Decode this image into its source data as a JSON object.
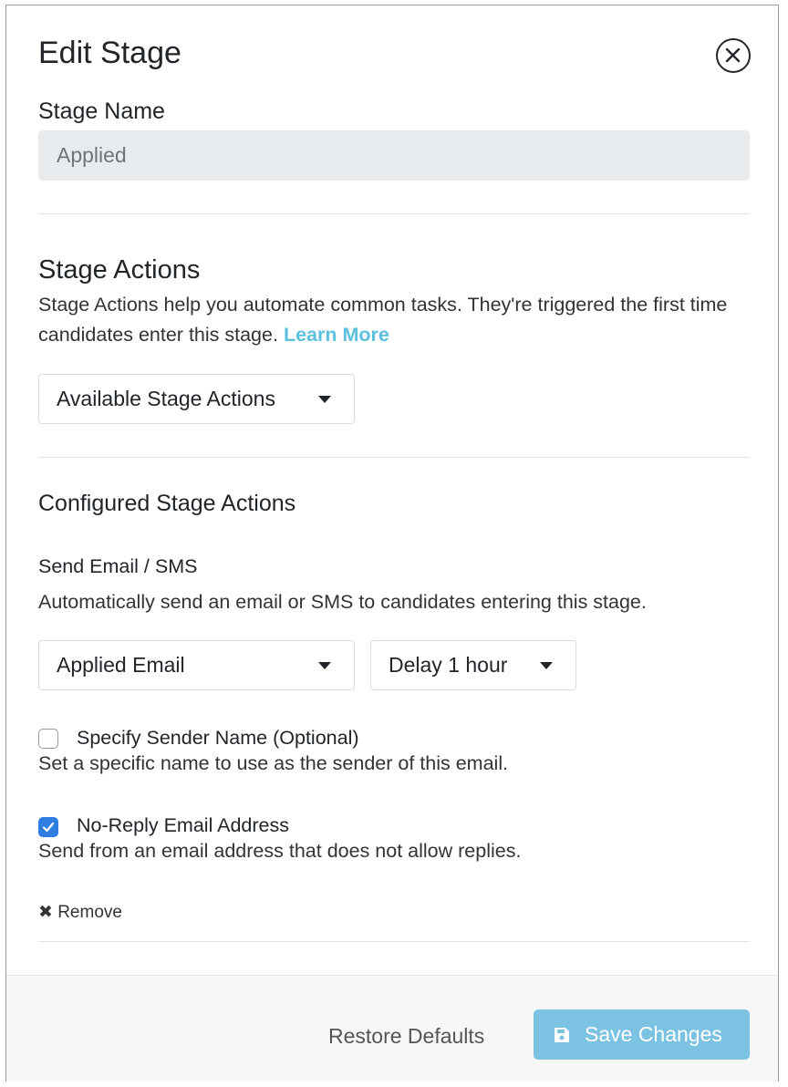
{
  "modal": {
    "title": "Edit Stage",
    "close_icon": "close-circle-icon"
  },
  "stage_name": {
    "label": "Stage Name",
    "value": "Applied"
  },
  "stage_actions": {
    "heading": "Stage Actions",
    "description": "Stage Actions help you automate common tasks. They're triggered the first time candidates enter this stage.",
    "learn_more": "Learn More",
    "dropdown_label": "Available Stage Actions"
  },
  "configured": {
    "heading": "Configured Stage Actions",
    "action_title": "Send Email / SMS",
    "action_description": "Automatically send an email or SMS to candidates entering this stage.",
    "template_select": "Applied Email",
    "delay_select": "Delay 1 hour",
    "sender_checkbox": {
      "label": "Specify Sender Name (Optional)",
      "help": "Set a specific name to use as the sender of this email.",
      "checked": false
    },
    "noreply_checkbox": {
      "label": "No-Reply Email Address",
      "help": "Send from an email address that does not allow replies.",
      "checked": true
    },
    "remove_label": "Remove"
  },
  "footer": {
    "restore_label": "Restore Defaults",
    "save_label": "Save Changes",
    "save_icon": "floppy-disk-icon"
  },
  "colors": {
    "accent": "#5bc0de",
    "save_button": "#7cc3e3",
    "checkbox_checked": "#2f7de1"
  }
}
